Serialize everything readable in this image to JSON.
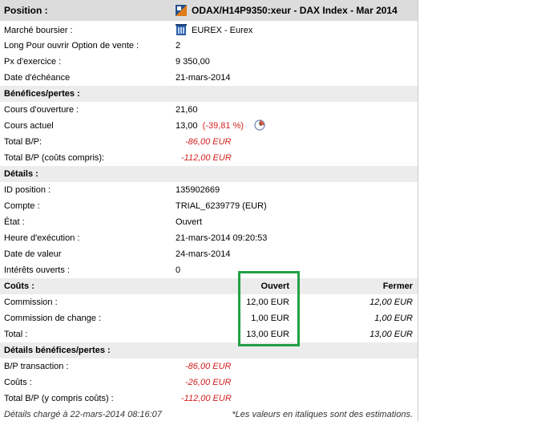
{
  "position": {
    "label": "Position :",
    "instrument": "ODAX/H14P9350:xeur - DAX Index - Mar 2014"
  },
  "details_top": [
    {
      "label": "Marché boursier :",
      "value": "EUREX - Eurex"
    },
    {
      "label": "Long  Pour ouvrir Option de vente :",
      "value": "2"
    },
    {
      "label": "Px d'exercice :",
      "value": "9 350,00"
    },
    {
      "label": "Date d'échéance",
      "value": "21-mars-2014"
    }
  ],
  "pnl": {
    "header": "Bénéfices/pertes :",
    "open_price_label": "Cours d'ouverture :",
    "open_price": "21,60",
    "current_price_label": "Cours actuel",
    "current_price": "13,00",
    "current_change": "(-39,81 %)",
    "total_label": "Total B/P:",
    "total": "-86,00 EUR",
    "total_costs_label": "Total B/P (coûts compris):",
    "total_costs": "-112,00 EUR"
  },
  "details": {
    "header": "Détails :",
    "rows": [
      {
        "label": "ID position :",
        "value": "135902669"
      },
      {
        "label": "Compte :",
        "value": "TRIAL_6239779 (EUR)"
      },
      {
        "label": "État :",
        "value": "Ouvert"
      },
      {
        "label": "Heure d'exécution :",
        "value": "21-mars-2014 09:20:53"
      },
      {
        "label": "Date de valeur",
        "value": "24-mars-2014"
      },
      {
        "label": "Intérêts ouverts :",
        "value": "0"
      }
    ]
  },
  "costs": {
    "header": "Coûts :",
    "col_open": "Ouvert",
    "col_close": "Fermer",
    "rows": [
      {
        "label": "Commission :",
        "open": "12,00 EUR",
        "close": "12,00 EUR"
      },
      {
        "label": "Commission de change :",
        "open": "1,00 EUR",
        "close": "1,00 EUR"
      },
      {
        "label": "Total :",
        "open": "13,00 EUR",
        "close": "13,00 EUR"
      }
    ]
  },
  "pnl_details": {
    "header": "Détails bénéfices/pertes :",
    "rows": [
      {
        "label": "B/P transaction :",
        "value": "-86,00 EUR"
      },
      {
        "label": "Coûts :",
        "value": "-26,00 EUR"
      },
      {
        "label": "Total B/P (y compris coûts) :",
        "value": "-112,00 EUR"
      }
    ]
  },
  "footer": {
    "loaded": "Détails chargé à 22-mars-2014 08:16:07",
    "note": "*Les valeurs en italiques sont des estimations."
  },
  "colors": {
    "negative": "#d32020",
    "highlight": "#23a046",
    "section_bg": "#ececec"
  },
  "icons": {
    "instrument": "option-instrument-icon",
    "exchange": "exchange-building-icon",
    "clock": "clock-icon"
  }
}
